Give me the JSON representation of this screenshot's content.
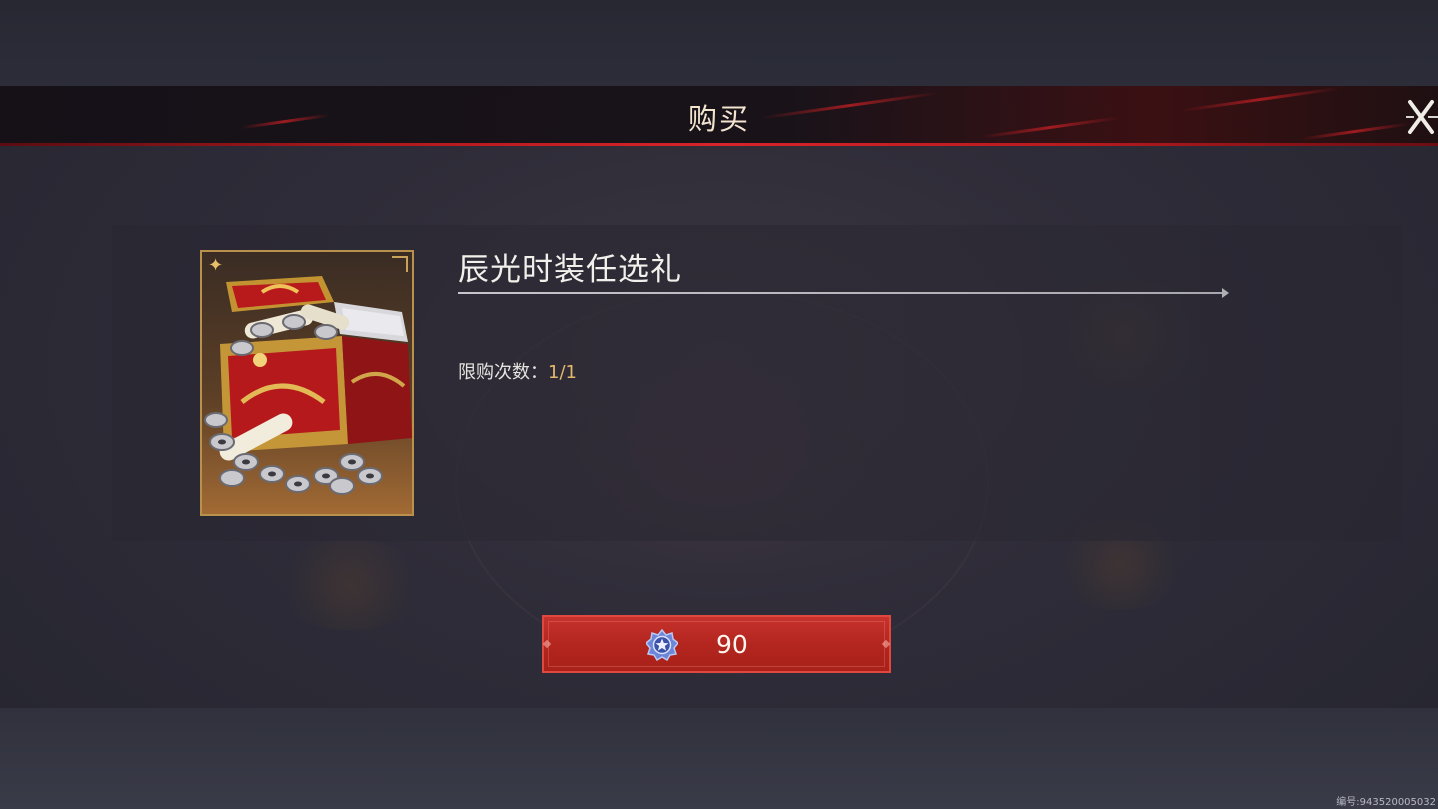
{
  "dialog": {
    "title": "购买",
    "close_icon": "close-x-icon"
  },
  "item": {
    "name": "辰光时装任选礼",
    "image_icon": "treasure-chest-icon",
    "limit_label": "限购次数：",
    "limit_value": "1/1"
  },
  "purchase": {
    "currency_icon": "star-gem-currency-icon",
    "price": "90"
  },
  "footer": {
    "serial": "编号:943520005032"
  },
  "colors": {
    "accent_red": "#c7322d",
    "title_line_red": "#d8242a",
    "gold": "#e2b86d",
    "title_text": "#f2e4cf"
  }
}
